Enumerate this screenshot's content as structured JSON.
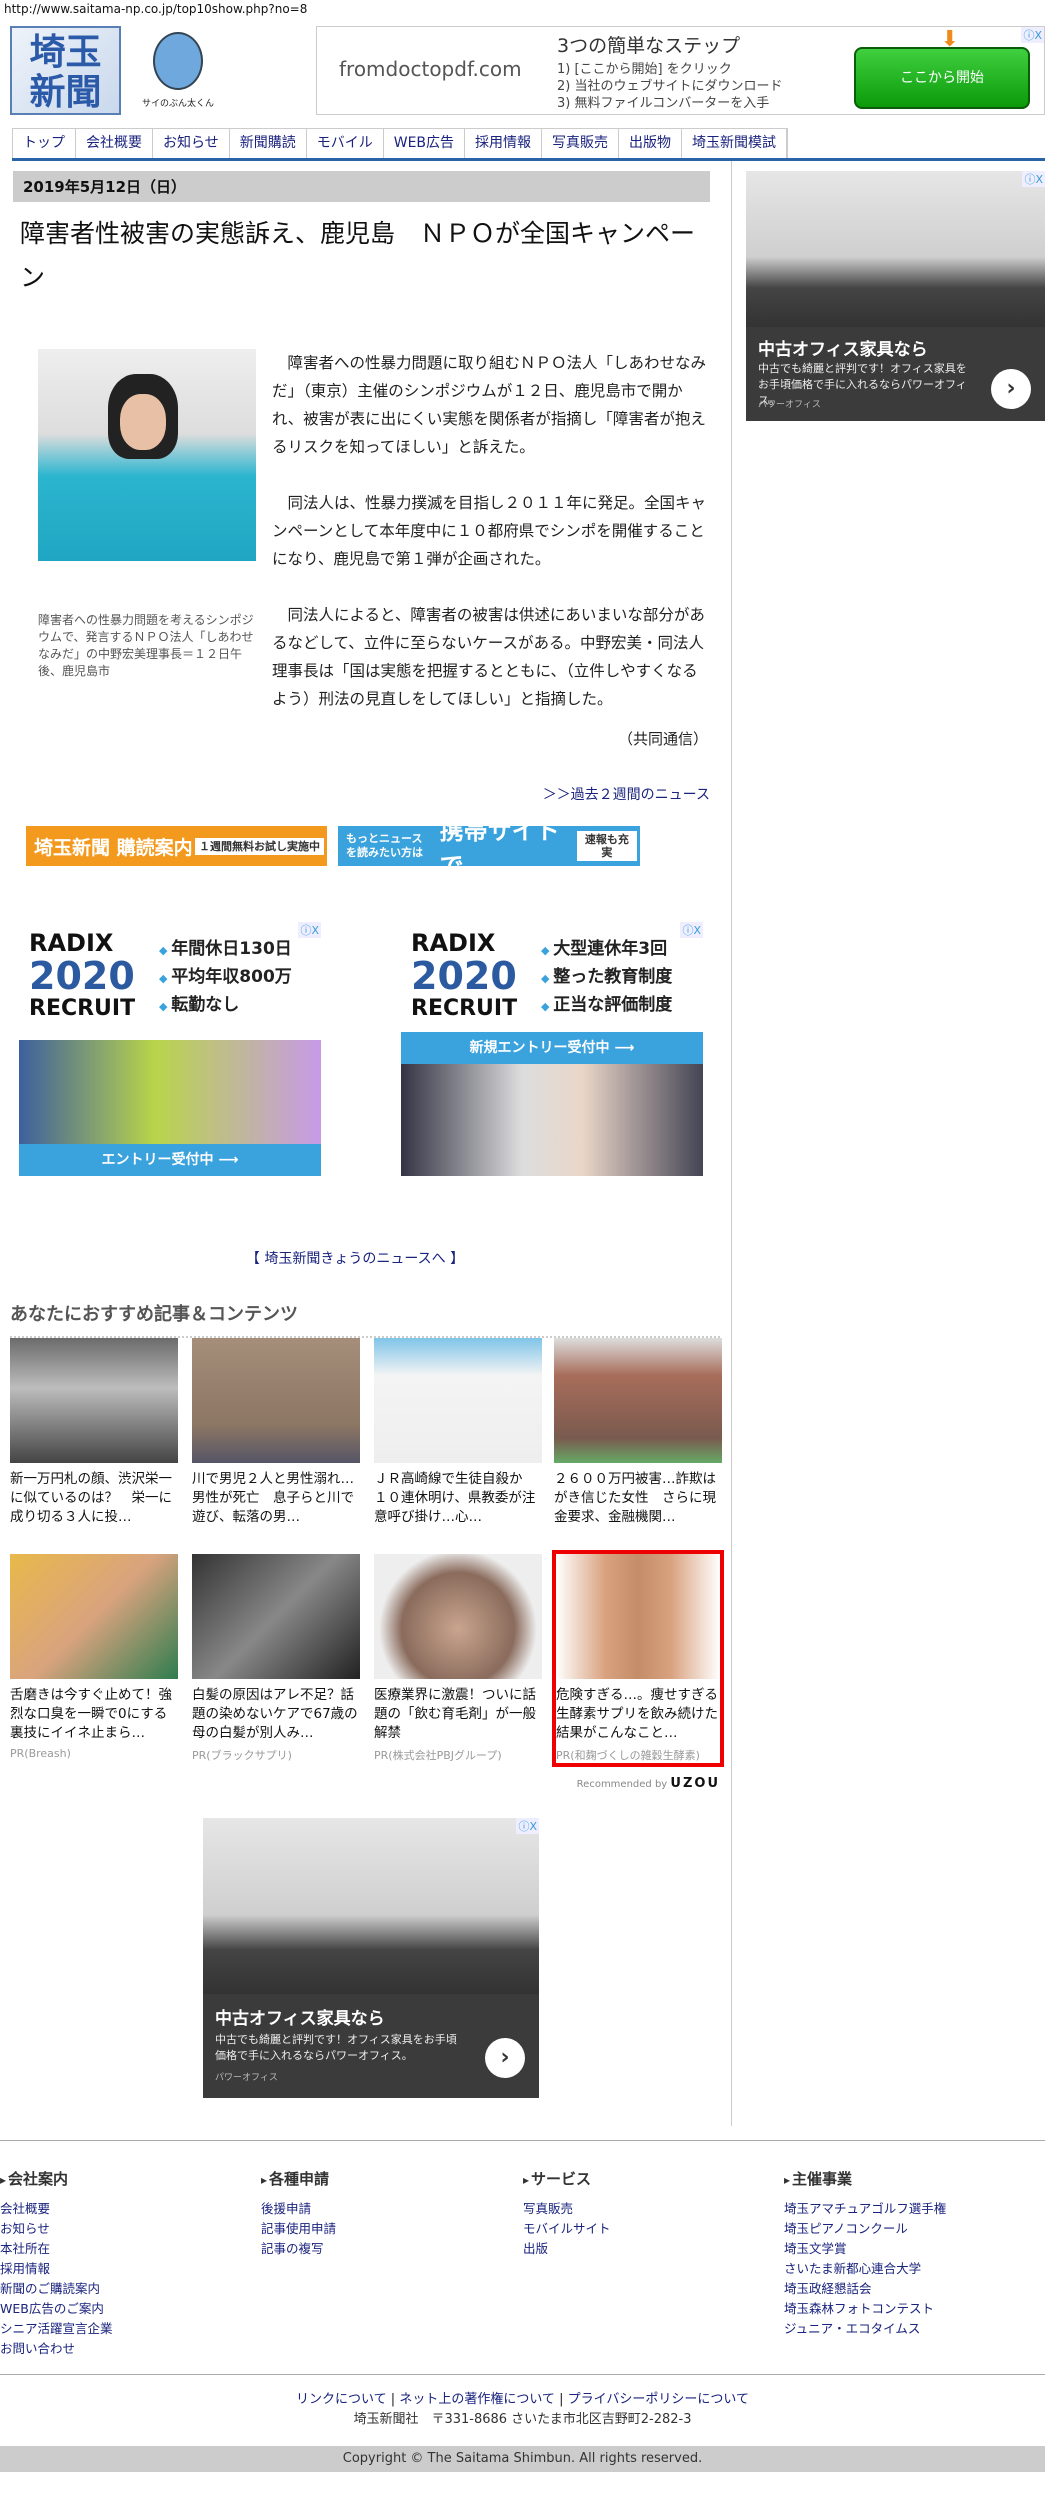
{
  "url": "http://www.saitama-np.co.jp/top10show.php?no=8",
  "header": {
    "logo_text": "埼玉新聞",
    "mascot_caption": "サイのぶん太くん",
    "ad": {
      "domain": "fromdoctopdf.com",
      "headline": "3つの簡単なステップ",
      "steps": [
        "1) [ここから開始] をクリック",
        "2) 当社のウェブサイトにダウンロード",
        "3) 無料ファイルコンバーターを入手"
      ],
      "cta": "ここから開始",
      "adchoices": "ⓘX"
    }
  },
  "nav": [
    "トップ",
    "会社概要",
    "お知らせ",
    "新聞購読",
    "モバイル",
    "WEB広告",
    "採用情報",
    "写真販売",
    "出版物",
    "埼玉新聞模試"
  ],
  "article": {
    "date": "2019年5月12日（日）",
    "title": "障害者性被害の実態訴え、鹿児島　ＮＰＯが全国キャンペーン",
    "caption": "障害者への性暴力問題を考えるシンポジウムで、発言するＮＰＯ法人「しあわせなみだ」の中野宏美理事長＝１２日午後、鹿児島市",
    "paragraphs": [
      "障害者への性暴力問題に取り組むＮＰＯ法人「しあわせなみだ」（東京）主催のシンポジウムが１２日、鹿児島市で開かれ、被害が表に出にくい実態を関係者が指摘し「障害者が抱えるリスクを知ってほしい」と訴えた。",
      "同法人は、性暴力撲滅を目指し２０１１年に発足。全国キャンペーンとして本年度中に１０都府県でシンポを開催することになり、鹿児島で第１弾が企画された。",
      "同法人によると、障害者の被害は供述にあいまいな部分があるなどして、立件に至らないケースがある。中野宏美・同法人理事長は「国は実態を把握するとともに、（立件しやすくなるよう）刑法の見直しをしてほしい」と指摘した。"
    ],
    "credit": "（共同通信）",
    "past_link": "＞＞過去２週間のニュース"
  },
  "banners": {
    "subscribe": {
      "main": "埼玉新聞 購読案内",
      "box": "１週間無料お試し実施中"
    },
    "mobile": {
      "small": "もっとニュースを読みたい方は",
      "main": "携帯サイトで",
      "box": "速報も充実"
    }
  },
  "radix_ads": [
    {
      "brand": "RADIX",
      "year": "2020",
      "sub": "RECRUIT",
      "points": [
        "年間休日130日",
        "平均年収800万",
        "転勤なし"
      ],
      "bar": "エントリー受付中 ⟶"
    },
    {
      "brand": "RADIX",
      "year": "2020",
      "sub": "RECRUIT",
      "points": [
        "大型連休年3回",
        "整った教育制度",
        "正当な評価制度"
      ],
      "bar": "新規エントリー受付中 ⟶"
    }
  ],
  "today_link": "【 埼玉新聞きょうのニュースへ 】",
  "recommend": {
    "heading": "あなたにおすすめ記事＆コンテンツ",
    "items": [
      {
        "title": "新一万円札の顔、渋沢栄一に似ているのは？　栄一に成り切る３人に投…"
      },
      {
        "title": "川で男児２人と男性溺れ…男性が死亡　息子らと川で遊び、転落の男…"
      },
      {
        "title": "ＪＲ高崎線で生徒自殺か　１０連休明け、県教委が注意呼び掛け…心…"
      },
      {
        "title": "２６００万円被害…詐欺はがき信じた女性　さらに現金要求、金融機関…"
      },
      {
        "title": "舌磨きは今すぐ止めて！強烈な口臭を一瞬で0にする裏技にイイネ止まら…",
        "pr": "PR(Breash)"
      },
      {
        "title": "白髪の原因はアレ不足？話題の染めないケアで67歳の母の白髪が別人み…",
        "pr": "PR(ブラックサプリ)"
      },
      {
        "title": "医療業界に激震！ついに話題の「飲む育毛剤」が一般解禁",
        "pr": "PR(株式会社PBJグループ)"
      },
      {
        "title": "危険すぎる…。痩せすぎる生酵素サプリを飲み続けた結果がこんなこと…",
        "pr": "PR(和麹づくしの雑穀生酵素)"
      }
    ],
    "recommended_by": "Recommended by",
    "uzou": "UZOU"
  },
  "office_ad": {
    "headline": "中古オフィス家具なら",
    "desc": "中古でも綺麗と評判です！オフィス家具をお手頃価格で手に入れるならパワーオフィス。",
    "sponsor": "パワーオフィス",
    "adchoices": "ⓘX"
  },
  "footer": {
    "columns": [
      {
        "heading": "会社案内",
        "links": [
          "会社概要",
          "お知らせ",
          "本社所在",
          "採用情報",
          "新聞のご購読案内",
          "WEB広告のご案内",
          "シニア活躍宣言企業",
          "お問い合わせ"
        ]
      },
      {
        "heading": "各種申請",
        "links": [
          "後援申請",
          "記事使用申請",
          "記事の複写"
        ]
      },
      {
        "heading": "サービス",
        "links": [
          "写真販売",
          "モバイルサイト",
          "出版"
        ]
      },
      {
        "heading": "主催事業",
        "links": [
          "埼玉アマチュアゴルフ選手権",
          "埼玉ピアノコンクール",
          "埼玉文学賞",
          "さいたま新都心連合大学",
          "埼玉政経懇話会",
          "埼玉森林フォトコンテスト",
          "ジュニア・エコタイムス"
        ]
      }
    ],
    "bottom_links": [
      "リンクについて",
      "ネット上の著作権について",
      "プライバシーポリシーについて"
    ],
    "address": "埼玉新聞社　〒331-8686 さいたま市北区吉野町2-282-3",
    "copyright": "Copyright © The Saitama Shimbun. All rights reserved."
  }
}
